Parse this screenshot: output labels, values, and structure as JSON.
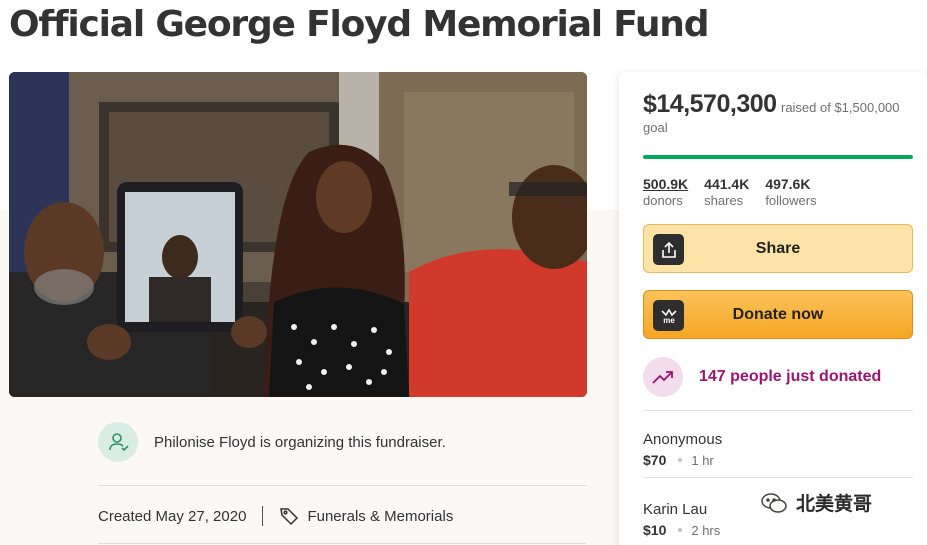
{
  "page": {
    "title": "Official George Floyd Memorial Fund"
  },
  "hero": {
    "image_name": "family-photo"
  },
  "organizer": {
    "text": "Philonise Floyd is organizing this fundraiser.",
    "icon": "organizer-icon"
  },
  "meta": {
    "created": "Created May 27, 2020",
    "category": "Funerals & Memorials",
    "category_icon": "tag-icon"
  },
  "donate_card": {
    "raised_amount": "$14,570,300",
    "raised_suffix": "raised of $1,500,000 goal",
    "progress_fraction": 1.0,
    "progress_color": "#02a95c",
    "stats": [
      {
        "value": "500.9K",
        "label": "donors"
      },
      {
        "value": "441.4K",
        "label": "shares"
      },
      {
        "value": "497.6K",
        "label": "followers"
      }
    ],
    "share_label": "Share",
    "share_icon": "share-icon",
    "donate_label": "Donate now",
    "donate_icon": "gofundme-icon",
    "recent_text": "147 people just donated",
    "recent_icon": "trending-up-icon",
    "accent_color": "#9b1373",
    "donations": [
      {
        "name": "Anonymous",
        "amount": "$70",
        "time": "1 hr"
      },
      {
        "name": "Karin Lau",
        "amount": "$10",
        "time": "2 hrs"
      }
    ]
  },
  "watermark": {
    "text": "北美黄哥"
  }
}
